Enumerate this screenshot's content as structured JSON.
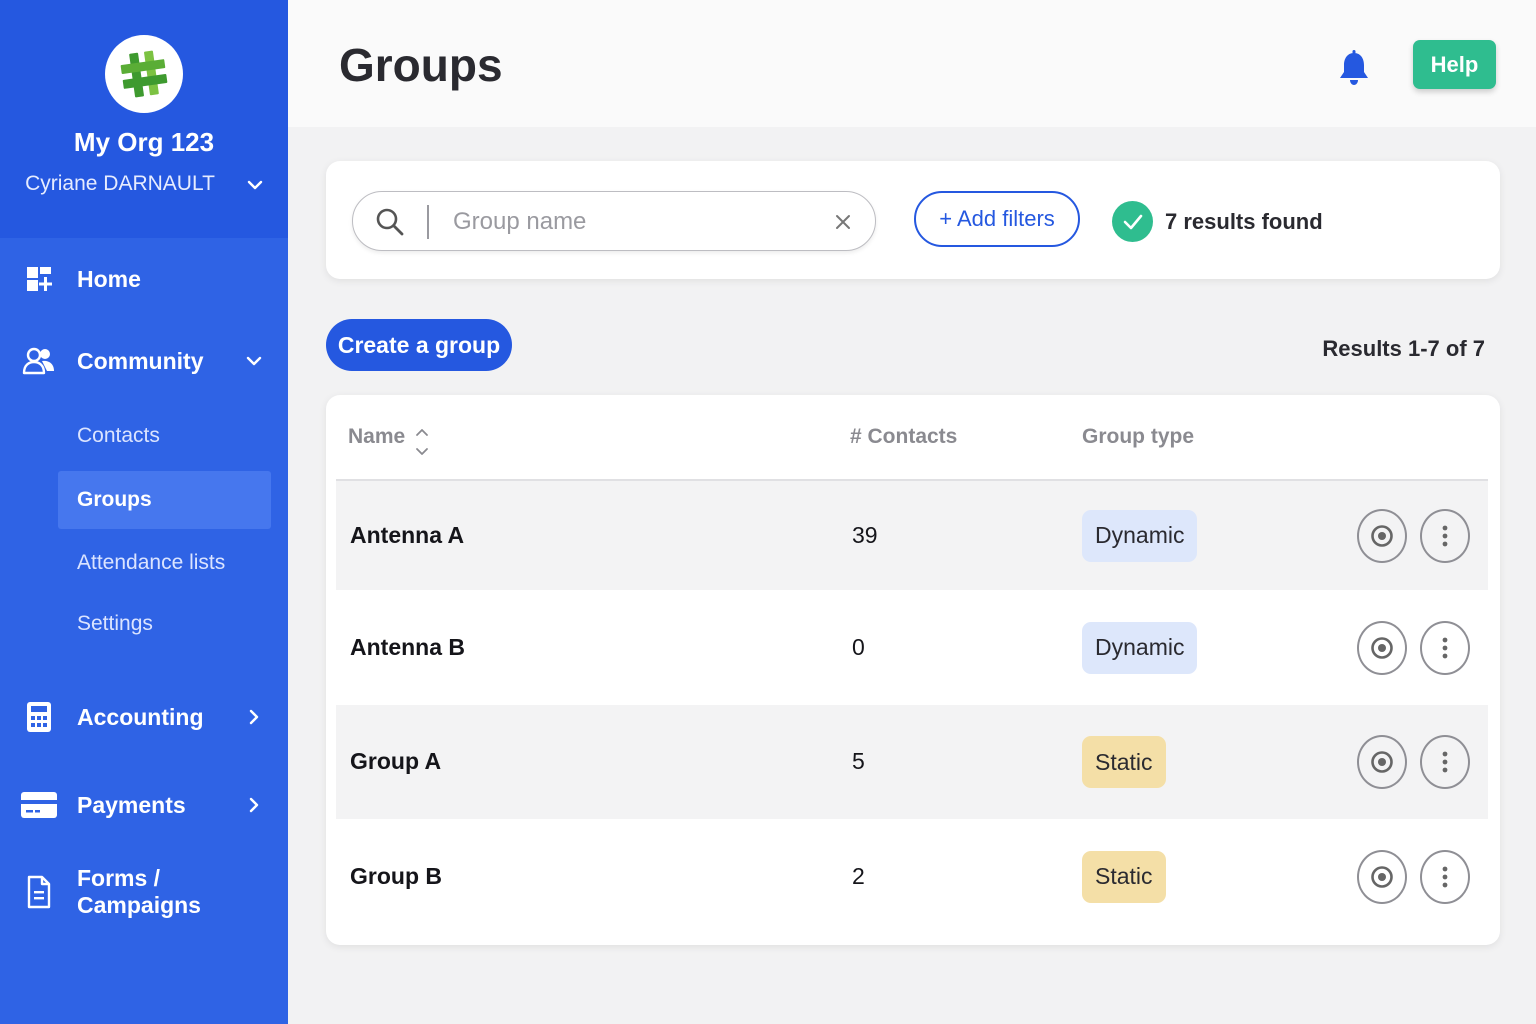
{
  "sidebar": {
    "org_name": "My Org 123",
    "user_name": "Cyriane DARNAULT",
    "nav": {
      "home": "Home",
      "community": "Community",
      "accounting": "Accounting",
      "payments": "Payments",
      "forms": "Forms / Campaigns"
    },
    "community_sub": {
      "contacts": "Contacts",
      "groups": "Groups",
      "attendance": "Attendance lists",
      "settings": "Settings"
    },
    "active_item": "Groups"
  },
  "header": {
    "title": "Groups",
    "help_label": "Help"
  },
  "filters": {
    "search_placeholder": "Group name",
    "search_value": "",
    "add_filters_label": "+ Add filters",
    "results_found": "7 results found"
  },
  "actions": {
    "create_group_label": "Create a group",
    "results_range": "Results 1-7 of 7"
  },
  "table": {
    "columns": {
      "name": "Name",
      "contacts": "# Contacts",
      "type": "Group type"
    },
    "rows": [
      {
        "name": "Antenna A",
        "contacts": "39",
        "type": "Dynamic"
      },
      {
        "name": "Antenna B",
        "contacts": "0",
        "type": "Dynamic"
      },
      {
        "name": "Group A",
        "contacts": "5",
        "type": "Static"
      },
      {
        "name": "Group B",
        "contacts": "2",
        "type": "Static"
      }
    ]
  },
  "icons": {
    "logo": "hashtag-logo-icon",
    "bell": "bell-icon",
    "search": "search-icon",
    "clear": "close-icon",
    "check": "check-icon",
    "view": "eye-icon",
    "more": "more-vertical-icon"
  },
  "colors": {
    "sidebar": "#2f63e5",
    "primary": "#2558e0",
    "success": "#2fbd8f",
    "dynamic_badge": "#dde7fb",
    "static_badge": "#f4dfa7"
  }
}
